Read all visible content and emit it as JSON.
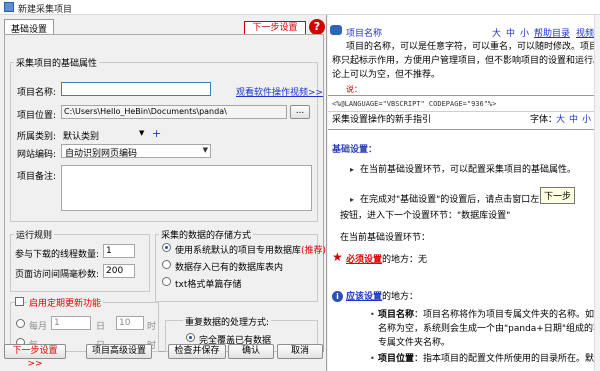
{
  "window": {
    "title": "新建采集项目"
  },
  "left": {
    "tab_label": "基础设置",
    "next_top": "下一步设置>>",
    "help_badge": "?",
    "basic_group": {
      "title": "采集项目的基础属性",
      "name_label": "项目名称:",
      "name_value": "",
      "video_link": "观看软件操作视频>>",
      "location_label": "项目位置:",
      "location_value": "C:\\Users\\Hello_HeBin\\Documents\\panda\\",
      "browse_label": "...",
      "category_label": "所属类别:",
      "category_value": "默认类别",
      "add_category": "+",
      "encoding_label": "网站编码:",
      "encoding_value": "自动识别网页编码",
      "note_label": "项目备注:",
      "note_value": ""
    },
    "run_group": {
      "title": "运行规则",
      "threads_label": "参与下载的线程数量:",
      "threads_value": "1",
      "interval_label": "页面访问间隔毫秒数:",
      "interval_value": "200"
    },
    "storage_group": {
      "title": "采集的数据的存储方式",
      "options": [
        {
          "label": "使用系统默认的项目专用数据库",
          "extra": "(推荐)",
          "selected": true
        },
        {
          "label": "数据存入已有的数据库表内",
          "extra": "",
          "selected": false
        },
        {
          "label": "txt格式单篇存储",
          "extra": "",
          "selected": false
        }
      ]
    },
    "schedule_group": {
      "title": "启用定期更新功能",
      "enabled": false,
      "row_options": [
        "每月",
        "每"
      ],
      "row1_value": "1",
      "row1_unit": "日",
      "row1_hour": "10",
      "row1_time_unit": "时",
      "row2_unit": "日",
      "row2_time_unit": "时"
    },
    "duplicate_group": {
      "title": "重复数据的处理方式:",
      "options": [
        {
          "label": "完全覆盖已有数据",
          "selected": true
        },
        {
          "label": "",
          "selected": false
        }
      ]
    },
    "buttons": {
      "next": "下一步设置>>",
      "advanced": "项目高级设置",
      "check_save": "检查并保存",
      "ok": "确认",
      "cancel": "取消"
    }
  },
  "right": {
    "help_title": "项目名称",
    "font_large": "大",
    "font_medium": "中",
    "font_small": "小",
    "help_contents": "帮助目录",
    "video": "视频",
    "help_lines": [
      "项目的名称，可以是任意字符，可以重名，可以随时修改。项目名",
      "称只起标示作用，方便用户管理项目，但不影响项目的设置和运行。理",
      "论上可以为空，但不推荐。"
    ],
    "cut_text": "说：",
    "code_line": "<%@LANGUAGE=\"VBSCRIPT\" CODEPAGE=\"936\"%>",
    "guide_title": "采集设置操作的新手指引",
    "font_label": "字体：",
    "section_basic": "基础设置：",
    "para1": "在当前基础设置环节，可以配置采集项目的基础属性。",
    "para2_a": "在完成对\"基础设置\"的设置后，请点击窗口左下的",
    "tooltip": "下一步",
    "para2_b": "按钮，进入下一个设置环节：\"数据库设置\"",
    "para3": "在当前基础设置环节：",
    "required_prefix": "必须设置",
    "required_suffix": "的地方：无",
    "optional_prefix": "应该设置",
    "optional_suffix": "的地方：",
    "item1_name": "项目名称",
    "item1_text": "：项目名称将作为项目专属文件夹的名称。如果项目",
    "item1_text2": "名称为空，系统则会生成一个由\"panda+日期\"组成的项目",
    "item1_text3": "专属文件夹名称。",
    "item2_name": "项目位置",
    "item2_text": "：指本项目的配置文件所使用的目录所在。默认"
  }
}
